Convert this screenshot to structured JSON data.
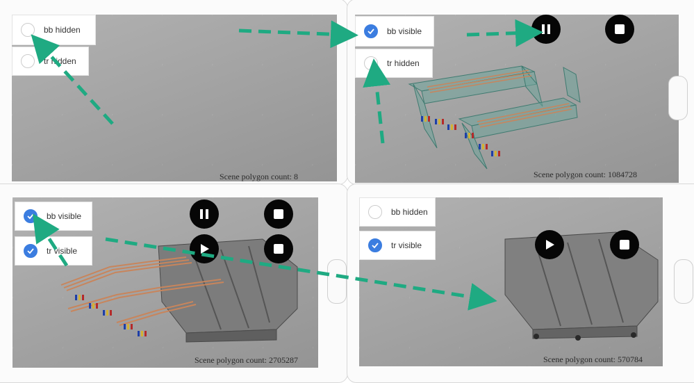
{
  "colors": {
    "checkbox_on": "#3b7de0",
    "arrow": "#1faa82",
    "control": "#060606",
    "bus_bar": "#c8855c",
    "transformer": "#5b5b5b"
  },
  "panels": [
    {
      "toggles": [
        {
          "label": "bb hidden",
          "checked": false
        },
        {
          "label": "tr hidden",
          "checked": false
        }
      ],
      "polygon_count": "Scene polygon count: 8"
    },
    {
      "toggles": [
        {
          "label": "bb visible",
          "checked": true
        },
        {
          "label": "tr hidden",
          "checked": false
        }
      ],
      "controls": [
        {
          "icon": "pause-icon"
        },
        {
          "icon": "stop-icon"
        }
      ],
      "polygon_count": "Scene polygon count: 1084728"
    },
    {
      "toggles": [
        {
          "label": "bb visible",
          "checked": true
        },
        {
          "label": "tr visible",
          "checked": true
        }
      ],
      "controls": [
        {
          "icon": "pause-icon"
        },
        {
          "icon": "stop-icon"
        },
        {
          "icon": "play-icon"
        },
        {
          "icon": "stop-icon"
        }
      ],
      "polygon_count": "Scene polygon count: 2705287"
    },
    {
      "toggles": [
        {
          "label": "bb hidden",
          "checked": false
        },
        {
          "label": "tr visible",
          "checked": true
        }
      ],
      "controls": [
        {
          "icon": "play-icon"
        },
        {
          "icon": "stop-icon"
        }
      ],
      "polygon_count": "Scene polygon count: 570784"
    }
  ]
}
